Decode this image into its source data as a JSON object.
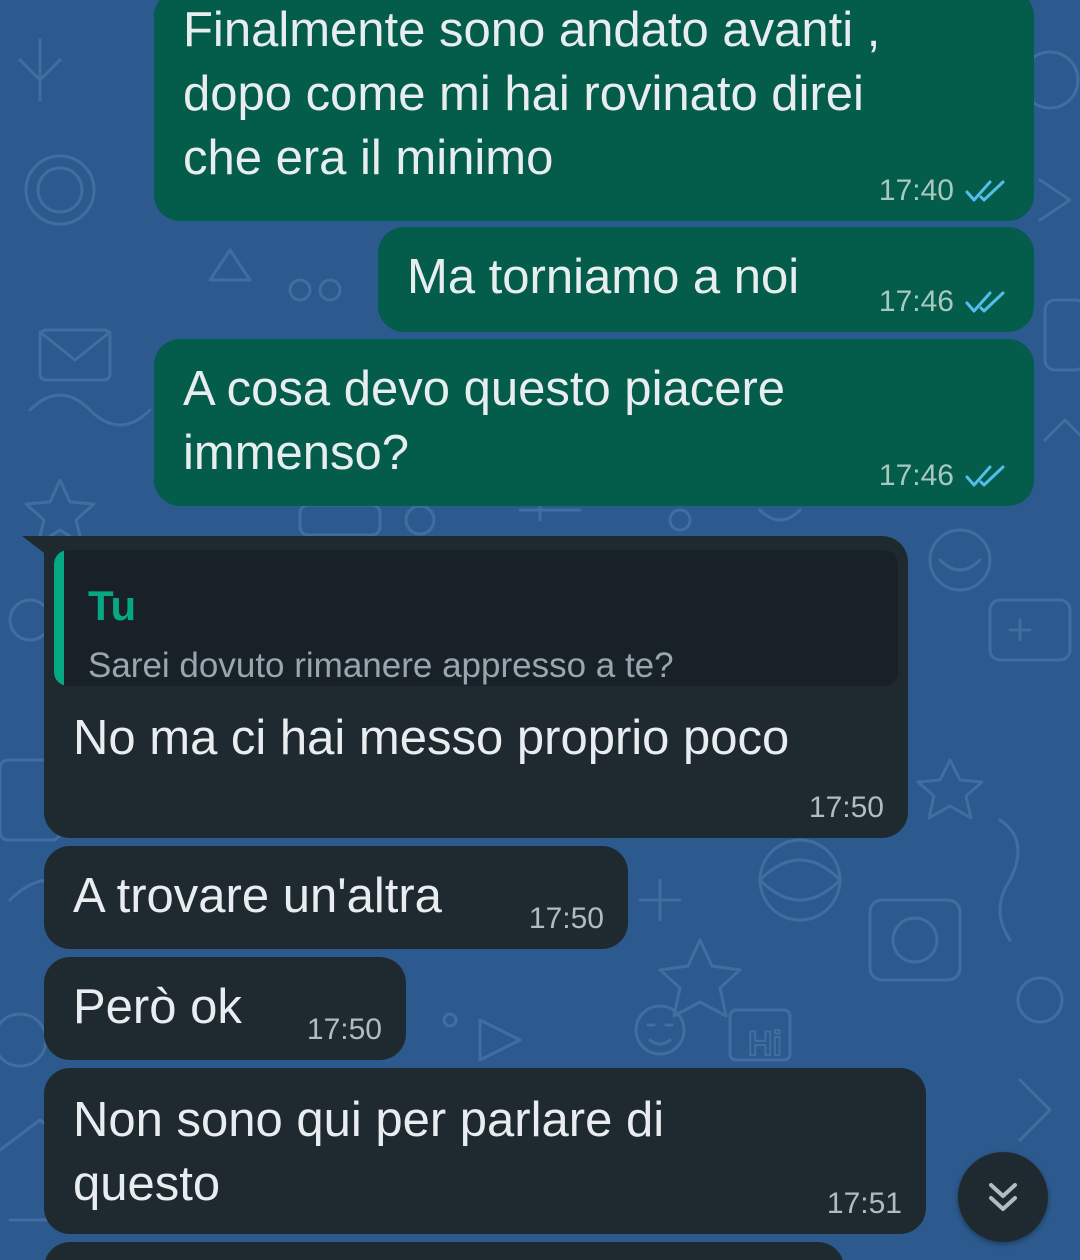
{
  "colors": {
    "wallpaper": "#2d5a8e",
    "outgoing_bubble": "#035d4a",
    "incoming_bubble": "#1f2a30",
    "quote_accent": "#06a884",
    "read_ticks": "#53bdeb"
  },
  "messages": [
    {
      "direction": "outgoing",
      "text": "Finalmente sono andato avanti ,\ndopo come mi hai rovinato direi\nche era il minimo",
      "time": "17:40",
      "status": "read"
    },
    {
      "direction": "outgoing",
      "text": "Ma torniamo a noi",
      "time": "17:46",
      "status": "read"
    },
    {
      "direction": "outgoing",
      "text": "A cosa devo questo piacere\nimmenso?",
      "time": "17:46",
      "status": "read"
    },
    {
      "direction": "incoming",
      "reply_to": {
        "author": "Tu",
        "text": "Sarei dovuto rimanere appresso a te?"
      },
      "text": "No ma ci hai messo proprio poco",
      "time": "17:50"
    },
    {
      "direction": "incoming",
      "text": "A trovare un'altra",
      "time": "17:50"
    },
    {
      "direction": "incoming",
      "text": "Però ok",
      "time": "17:50"
    },
    {
      "direction": "incoming",
      "text": "Non sono qui per parlare di\nquesto",
      "time": "17:51"
    }
  ],
  "scroll_button": {
    "icon": "double-chevron-down-icon"
  }
}
